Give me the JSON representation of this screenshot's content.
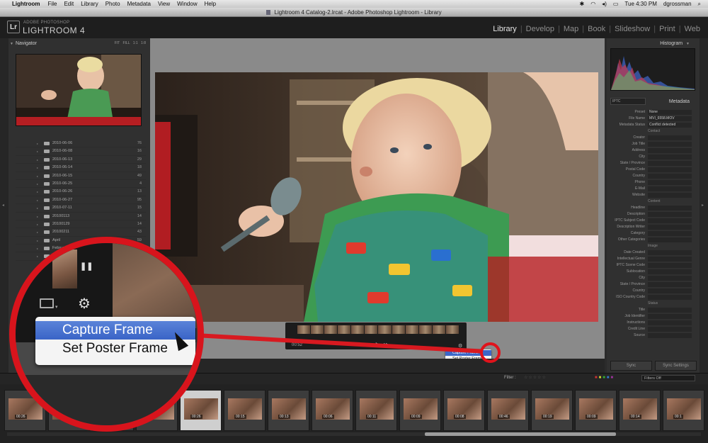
{
  "menubar": {
    "app_name": "Lightroom",
    "items": [
      "File",
      "Edit",
      "Library",
      "Photo",
      "Metadata",
      "View",
      "Window",
      "Help"
    ],
    "clock": "Tue 4:30 PM",
    "user": "dgrossman"
  },
  "window": {
    "title": "Lightroom 4 Catalog-2.lrcat - Adobe Photoshop Lightroom - Library"
  },
  "identity": {
    "badge": "Lr",
    "brand_small": "ADOBE PHOTOSHOP",
    "brand_big": "LIGHTROOM 4"
  },
  "modules": [
    {
      "label": "Library",
      "active": true
    },
    {
      "label": "Develop",
      "active": false
    },
    {
      "label": "Map",
      "active": false
    },
    {
      "label": "Book",
      "active": false
    },
    {
      "label": "Slideshow",
      "active": false
    },
    {
      "label": "Print",
      "active": false
    },
    {
      "label": "Web",
      "active": false
    }
  ],
  "navigator": {
    "title": "Navigator",
    "zoom_options": "FIT FILL 1:1 1:8"
  },
  "folders": [
    {
      "name": "2010-06-06",
      "count": "76"
    },
    {
      "name": "2010-06-08",
      "count": "16"
    },
    {
      "name": "2010-06-13",
      "count": "29"
    },
    {
      "name": "2010-06-14",
      "count": "18"
    },
    {
      "name": "2010-06-15",
      "count": "49"
    },
    {
      "name": "2010-06-25",
      "count": "4"
    },
    {
      "name": "2010-06-26",
      "count": "13"
    },
    {
      "name": "2010-06-27",
      "count": "95"
    },
    {
      "name": "2010-07-11",
      "count": "15"
    },
    {
      "name": "20100113",
      "count": "14"
    },
    {
      "name": "20100129",
      "count": "14"
    },
    {
      "name": "20100211",
      "count": "43"
    },
    {
      "name": "April",
      "count": "59"
    },
    {
      "name": "February",
      "count": ""
    },
    {
      "name": "Jan",
      "count": ""
    }
  ],
  "video": {
    "time": "00:52",
    "controls": "◂◂ ▶ ▸▸",
    "menu_items": [
      "Capture Frame",
      "Set Poster Frame"
    ],
    "selected_item": "Capture Frame"
  },
  "histogram": {
    "title": "Histogram"
  },
  "metadata": {
    "title": "Metadata",
    "preset_selector": "IPTC",
    "preset_label": "Preset",
    "preset_value": "None",
    "rows": [
      {
        "label": "File Name",
        "value": "MVI_6558.MOV"
      },
      {
        "label": "Metadata Status",
        "value": "Conflict detected"
      },
      {
        "section": "Contact"
      },
      {
        "label": "Creator",
        "value": ""
      },
      {
        "label": "Job Title",
        "value": ""
      },
      {
        "label": "Address",
        "value": ""
      },
      {
        "label": "City",
        "value": ""
      },
      {
        "label": "State / Province",
        "value": ""
      },
      {
        "label": "Postal Code",
        "value": ""
      },
      {
        "label": "Country",
        "value": ""
      },
      {
        "label": "Phone",
        "value": ""
      },
      {
        "label": "E-Mail",
        "value": ""
      },
      {
        "label": "Website",
        "value": ""
      },
      {
        "section": "Content"
      },
      {
        "label": "Headline",
        "value": ""
      },
      {
        "label": "Description",
        "value": ""
      },
      {
        "label": "IPTC Subject Code",
        "value": ""
      },
      {
        "label": "Description Writer",
        "value": ""
      },
      {
        "label": "Category",
        "value": ""
      },
      {
        "label": "Other Categories",
        "value": ""
      },
      {
        "section": "Image"
      },
      {
        "label": "Date Created",
        "value": ""
      },
      {
        "label": "Intellectual Genre",
        "value": ""
      },
      {
        "label": "IPTC Scene Code",
        "value": ""
      },
      {
        "label": "Sublocation",
        "value": ""
      },
      {
        "label": "City",
        "value": ""
      },
      {
        "label": "State / Province",
        "value": ""
      },
      {
        "label": "Country",
        "value": ""
      },
      {
        "label": "ISO Country Code",
        "value": ""
      },
      {
        "section": "Status"
      },
      {
        "label": "Title",
        "value": ""
      },
      {
        "label": "Job Identifier",
        "value": ""
      },
      {
        "label": "Instructions",
        "value": ""
      },
      {
        "label": "Credit Line",
        "value": ""
      },
      {
        "label": "Source",
        "value": ""
      }
    ],
    "sync_button": "Sync",
    "sync_settings_button": "Sync Settings"
  },
  "filter": {
    "label": "Filter :",
    "value": "Filters Off"
  },
  "filmstrip": {
    "cells": [
      {
        "duration": "00:26",
        "selected": false
      },
      {
        "duration": "",
        "selected": false
      },
      {
        "duration": "",
        "selected": false
      },
      {
        "duration": "",
        "selected": false
      },
      {
        "duration": "00:26",
        "selected": true
      },
      {
        "duration": "00:15",
        "selected": false
      },
      {
        "duration": "00:13",
        "selected": false
      },
      {
        "duration": "00:06",
        "selected": false
      },
      {
        "duration": "00:11",
        "selected": false
      },
      {
        "duration": "00:09",
        "selected": false
      },
      {
        "duration": "00:08",
        "selected": false
      },
      {
        "duration": "00:46",
        "selected": false
      },
      {
        "duration": "00:19",
        "selected": false
      },
      {
        "duration": "00:09",
        "selected": false
      },
      {
        "duration": "00:14",
        "selected": false
      },
      {
        "duration": "00:1",
        "selected": false
      }
    ]
  },
  "colors": {
    "callout_red": "#d8141c",
    "menu_highlight": "#3b67c9",
    "panel_bg": "#303030",
    "center_bg": "#8a8a8a"
  },
  "icons": {
    "pause": "pause-icon",
    "gear": "gear-icon",
    "screen": "screen-icon"
  }
}
